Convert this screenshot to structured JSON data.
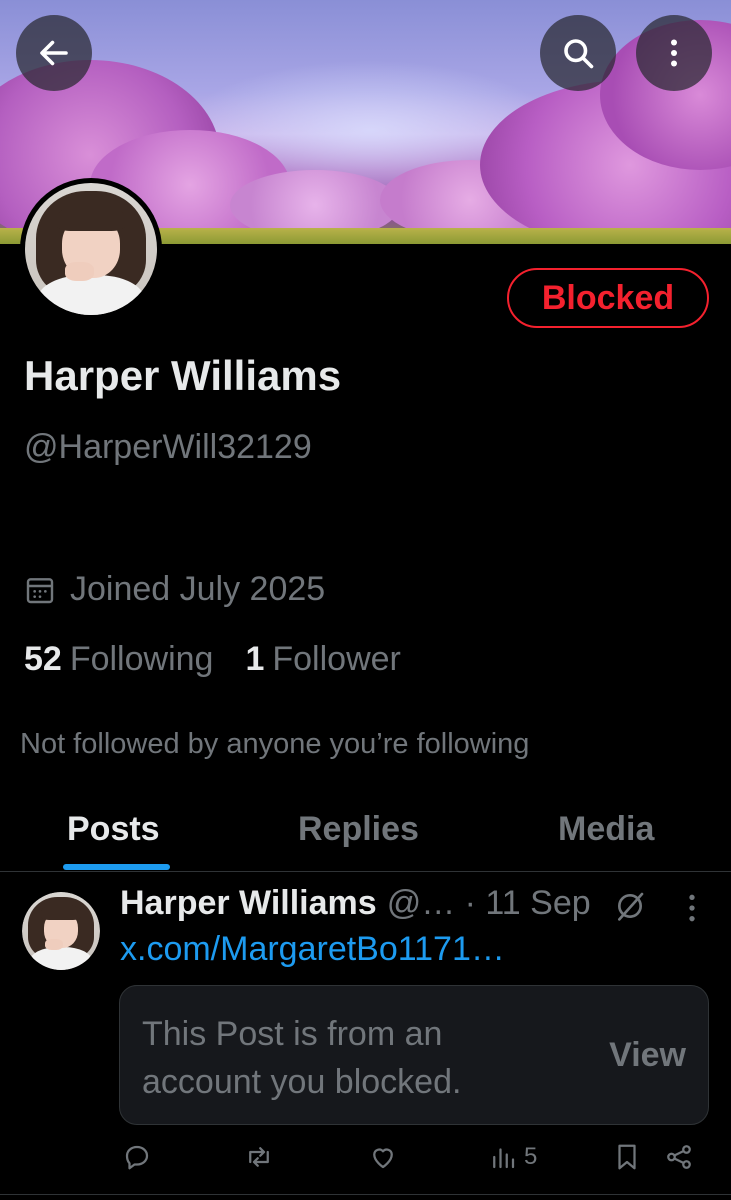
{
  "profile": {
    "name": "Harper Williams",
    "handle": "@HarperWill32129",
    "blocked_label": "Blocked",
    "joined": "Joined July 2025",
    "following_count": "52",
    "following_label": "Following",
    "followers_count": "1",
    "followers_label": "Follower",
    "mutuals_note": "Not followed by anyone you’re following"
  },
  "tabs": [
    {
      "label": "Posts",
      "active": true
    },
    {
      "label": "Replies",
      "active": false
    },
    {
      "label": "Media",
      "active": false
    }
  ],
  "post": {
    "author_name": "Harper Williams",
    "meta": "@… · 11 Sep",
    "link_text": "x.com/MargaretBo1171…",
    "blocked_message": "This Post is from an account you blocked.",
    "view_label": "View",
    "views_count": "5"
  },
  "icons": {
    "back": "arrow-left-icon",
    "search": "search-icon",
    "more": "more-vertical-icon",
    "calendar": "calendar-icon",
    "reply": "reply-icon",
    "repost": "repost-icon",
    "like": "heart-icon",
    "views": "views-icon",
    "bookmark": "bookmark-icon",
    "share": "share-icon"
  },
  "colors": {
    "background": "#000000",
    "text_primary": "#e7e9ea",
    "text_secondary": "#71767b",
    "accent_blue": "#1d9bf0",
    "blocked_red": "#f4212e",
    "card_bg": "#16181c"
  }
}
